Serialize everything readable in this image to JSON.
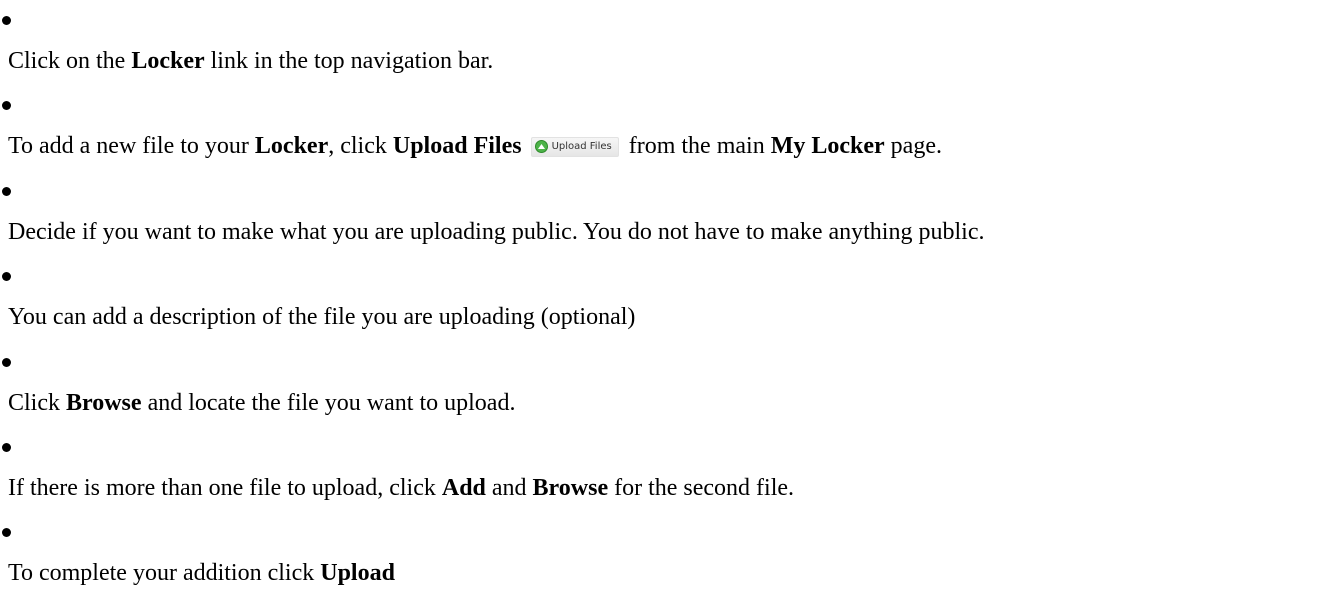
{
  "steps": [
    {
      "parts": [
        "Click on the ",
        "Locker",
        " link in the top navigation bar."
      ]
    },
    {
      "parts": [
        "To add a new file to your ",
        "Locker",
        ", click ",
        "Upload Files",
        " from the main ",
        "My Locker",
        " page."
      ],
      "button_label": "Upload Files"
    },
    {
      "text": "Decide if you want to make what you are uploading public. You do not have to make anything public."
    },
    {
      "text": "You can add a description of the file you are uploading (optional)"
    },
    {
      "parts": [
        "Click ",
        "Browse",
        " and locate the file you want to upload."
      ]
    },
    {
      "parts": [
        "If there is more than one file to upload, click ",
        "Add",
        " and ",
        "Browse",
        " for the second file."
      ]
    },
    {
      "parts": [
        "To complete your addition click ",
        "Upload"
      ]
    }
  ],
  "colors": {
    "text": "#000000",
    "button_icon": "#4cb348"
  },
  "icons": {
    "upload_button_icon": "green-circle-up-arrow-icon"
  }
}
